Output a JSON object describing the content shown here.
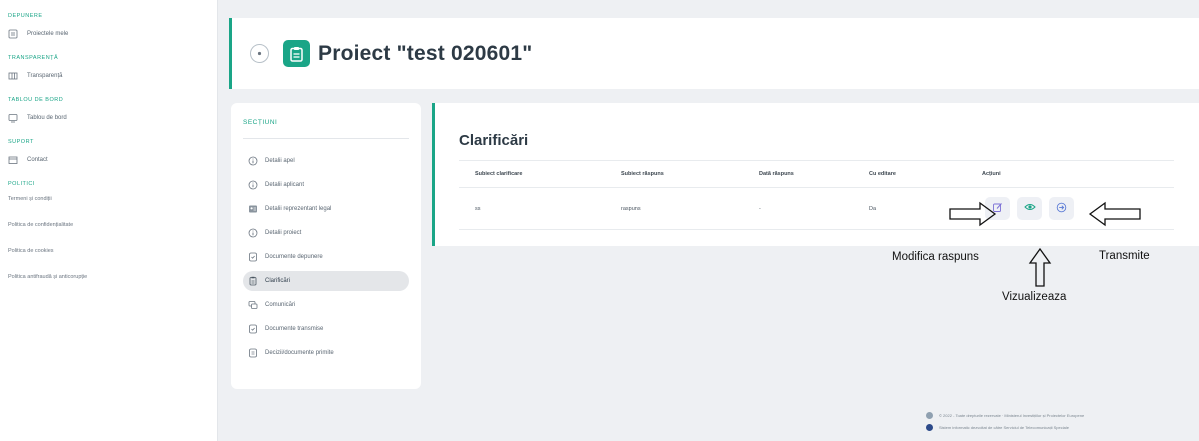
{
  "sidebar": {
    "groups": [
      {
        "heading": "Depunere",
        "items": [
          {
            "label": "Proiectele mele",
            "icon": "folder-icon"
          }
        ]
      },
      {
        "heading": "Transparență",
        "items": [
          {
            "label": "Transparență",
            "icon": "grid-icon"
          }
        ]
      },
      {
        "heading": "Tablou de bord",
        "items": [
          {
            "label": "Tablou de bord",
            "icon": "dashboard-icon"
          }
        ]
      },
      {
        "heading": "Suport",
        "items": [
          {
            "label": "Contact",
            "icon": "contact-icon"
          }
        ]
      }
    ],
    "policies_heading": "Politici",
    "links": [
      "Termeni și condiții",
      "Politica de confidențialitate",
      "Politica de cookies",
      "Politica antifraudă și anticorupție"
    ]
  },
  "header": {
    "title": "Proiect \"test 020601\"",
    "back_icon": "back-arrow-icon",
    "project_icon": "clipboard-icon"
  },
  "sections": {
    "title": "Secțiuni",
    "items": [
      {
        "label": "Detalii apel",
        "icon": "info-icon",
        "active": false
      },
      {
        "label": "Detalii aplicant",
        "icon": "info-icon",
        "active": false
      },
      {
        "label": "Detalii reprezentant legal",
        "icon": "id-card-icon",
        "active": false
      },
      {
        "label": "Detalii proiect",
        "icon": "info-icon",
        "active": false
      },
      {
        "label": "Documente depunere",
        "icon": "document-icon",
        "active": false
      },
      {
        "label": "Clarificări",
        "icon": "clarification-icon",
        "active": true
      },
      {
        "label": "Comunicări",
        "icon": "chat-icon",
        "active": false
      },
      {
        "label": "Documente transmise",
        "icon": "document-icon",
        "active": false
      },
      {
        "label": "Decizii/documente primite",
        "icon": "document-icon",
        "active": false
      }
    ]
  },
  "main": {
    "title": "Clarificări",
    "table": {
      "headers": [
        "Subiect clarificare",
        "Subiect răspuns",
        "Dată răspuns",
        "Cu editare",
        "Acțiuni"
      ],
      "rows": [
        {
          "subject": "ss",
          "response": "raspuns",
          "date": "-",
          "edit": "Da"
        }
      ]
    }
  },
  "annotations": {
    "edit": "Modifica raspuns",
    "view": "Vizualizeaza",
    "send": "Transmite"
  },
  "footer": {
    "line1": "© 2022 - Toate drepturile rezervate · Ministerul Investițiilor și Proiectelor Europene",
    "line2": "Sistem informatic dezvoltat de către Serviciul de Telecomunicații Speciale"
  },
  "colors": {
    "accent": "#1aa587",
    "background": "#eef0f3",
    "action_edit": "#7b6fd6",
    "action_view": "#1aa587",
    "action_send": "#5b7bd6"
  }
}
